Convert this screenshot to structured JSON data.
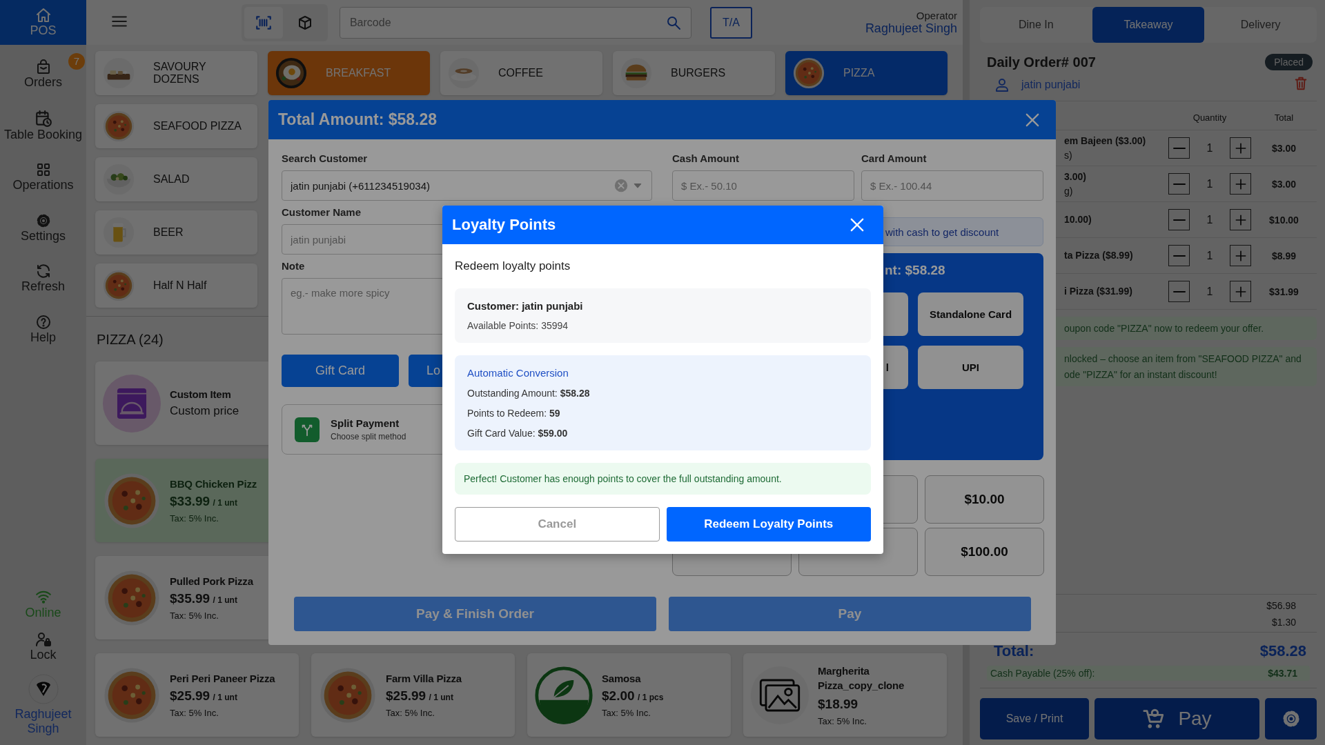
{
  "sidebar": {
    "items": [
      {
        "label": "POS",
        "selected": true
      },
      {
        "label": "Orders",
        "selected": false,
        "badge": "7"
      },
      {
        "label": "Table Booking",
        "selected": false
      },
      {
        "label": "Operations",
        "selected": false
      },
      {
        "label": "Settings",
        "selected": false
      },
      {
        "label": "Refresh",
        "selected": false
      },
      {
        "label": "Help",
        "selected": false
      }
    ],
    "status": {
      "label": "Online",
      "online": true
    },
    "lock": "Lock",
    "user": "Raghujeet Singh"
  },
  "topbar": {
    "scan_modes": [
      {
        "selected": true
      },
      {
        "selected": false
      }
    ],
    "barcode": {
      "placeholder": "Barcode"
    },
    "ta_button": "T/A",
    "operator_label": "Operator",
    "operator_name": "Raghujeet Singh"
  },
  "categories": [
    {
      "label": "SAVOURY DOZENS",
      "selected": false,
      "featured": false
    },
    {
      "label": "BREAKFAST",
      "selected": false,
      "featured": true
    },
    {
      "label": "COFFEE",
      "selected": false,
      "featured": false
    },
    {
      "label": "BURGERS",
      "selected": false,
      "featured": false
    },
    {
      "label": "PIZZA",
      "selected": true,
      "featured": false
    },
    {
      "label": "SEAFOOD PIZZA",
      "selected": false,
      "featured": false
    },
    {
      "label": "SALAD",
      "selected": false,
      "featured": false
    },
    {
      "label": "BEER",
      "selected": false,
      "featured": false
    },
    {
      "label": "Half N Half",
      "selected": false,
      "featured": false
    }
  ],
  "category_heading": "PIZZA (24)",
  "products": [
    {
      "kind": "custom",
      "name": "Custom Item",
      "price": "Custom price",
      "selected": false
    },
    {
      "kind": "pizza",
      "name": "BBQ Chicken Pizz",
      "price": "$33.99",
      "unit": "/ 1 unt",
      "tax": "Tax: 5% Inc.",
      "selected": true
    },
    {
      "kind": "pizza",
      "name": "Pulled Pork Pizza",
      "price": "$35.99",
      "unit": "/ 1 unt",
      "tax": "Tax: 5% Inc.",
      "selected": false
    },
    {
      "kind": "pizza",
      "name": "Peri Peri Paneer Pizza",
      "price": "$25.99",
      "unit": "/ 1 unt",
      "tax": "Tax: 5% Inc.",
      "selected": false
    },
    {
      "kind": "pizza",
      "name": "Farm Villa Pizza",
      "price": "$25.99",
      "unit": "/ 1 unt",
      "tax": "Tax: 5% Inc.",
      "selected": false
    },
    {
      "kind": "vegan",
      "name": "Samosa",
      "price": "$2.00",
      "unit": "/ 1 pcs",
      "tax": "Tax: 5% Inc.",
      "selected": false
    },
    {
      "kind": "no_image",
      "name": "Margherita Pizza_copy_clone",
      "price": "$18.99",
      "tax": "Tax: 5% Inc.",
      "selected": false
    }
  ],
  "order_types": [
    {
      "label": "Dine In",
      "selected": false
    },
    {
      "label": "Takeaway",
      "selected": true
    },
    {
      "label": "Delivery",
      "selected": false
    }
  ],
  "order": {
    "title": "Daily Order# 007",
    "status": "Placed",
    "customer": "jatin punjabi",
    "columns": [
      "Quantity",
      "Total"
    ],
    "items": [
      {
        "name": "em Bajeen ($3.00)",
        "note": "s)",
        "quantity": "1",
        "total": "$3.00"
      },
      {
        "name": "3.00)",
        "note": "g)",
        "quantity": "1",
        "total": "$3.00"
      },
      {
        "name": "10.00)",
        "quantity": "1",
        "total": "$10.00"
      },
      {
        "name": "ta Pizza ($8.99)",
        "quantity": "1",
        "total": "$8.99"
      },
      {
        "name": "i Pizza ($31.99)",
        "quantity": "1",
        "total": "$31.99"
      }
    ],
    "notices": [
      "oupon code \"PIZZA\" now to redeem your offer.",
      "nlocked – choose an item from \"SEAFOOD PIZZA\" and ode \"PIZZA\" for an instant discount!"
    ],
    "subtotals": [
      "$56.98",
      "$1.30"
    ],
    "total_label": "Total:",
    "total": "$58.28",
    "cash_payable_label": "Cash Payable (25% off):",
    "cash_payable": "$43.71"
  },
  "actions": {
    "save": "Save / Print",
    "pay": "Pay"
  },
  "payment": {
    "title": "Total Amount: $58.28",
    "search_label": "Search Customer",
    "search_value": "jatin punjabi (+611234519034)",
    "name_label": "Customer Name",
    "name_value": "jatin punjabi",
    "note_label": "Note",
    "note_placeholder": "eg.- make more spicy",
    "gift_card": "Gift Card",
    "loyalty_button": "Lo",
    "split_title": "Split Payment",
    "split_subtitle": "Choose split method",
    "cash_label": "Cash Amount",
    "cash_placeholder": "$ Ex.- 50.10",
    "card_label": "Card Amount",
    "card_placeholder": "$ Ex.- 100.44",
    "cash_hint": "with cash to get discount",
    "amount_title": "nt: $58.28",
    "method_rows": [
      {
        "right": "Standalone Card"
      },
      {
        "middle": "l",
        "right": "UPI"
      }
    ],
    "quick_amounts": [
      "$10.00",
      "$100.00"
    ],
    "finish_button": "Pay & Finish Order",
    "pay_button": "Pay"
  },
  "loyalty": {
    "title": "Loyalty Points",
    "subtitle": "Redeem loyalty points",
    "customer": "Customer: jatin punjabi",
    "available": "Available Points: 35994",
    "conversion_title": "Automatic Conversion",
    "lines": [
      "Outstanding Amount: **$58.28**",
      "Points to Redeem: **59**",
      "Gift Card Value: **$59.00**"
    ],
    "message": "Perfect! Customer has enough points to cover the full outstanding amount.",
    "cancel": "Cancel",
    "confirm": "Redeem Loyalty Points"
  }
}
